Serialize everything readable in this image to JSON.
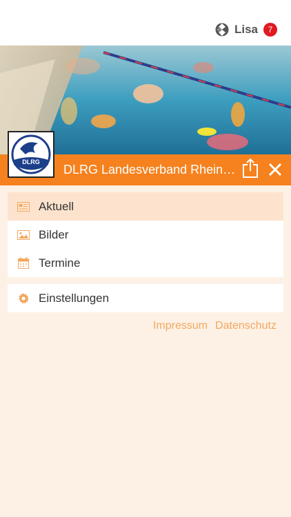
{
  "header": {
    "user_name": "Lisa",
    "notification_count": "7",
    "app_icon": "app-logo-icon"
  },
  "organization": {
    "title": "DLRG Landesverband Rheinland-Pfalz e.V.",
    "logo_text": "DLRG",
    "share_icon": "share-icon",
    "close_icon": "close-icon",
    "accent_color": "#f5821f"
  },
  "menu": {
    "items": [
      {
        "label": "Aktuell",
        "icon": "newspaper-icon",
        "active": true
      },
      {
        "label": "Bilder",
        "icon": "image-icon",
        "active": false
      },
      {
        "label": "Termine",
        "icon": "calendar-icon",
        "active": false
      }
    ],
    "settings": {
      "label": "Einstellungen",
      "icon": "gear-icon"
    }
  },
  "footer": {
    "impressum": "Impressum",
    "datenschutz": "Datenschutz"
  }
}
